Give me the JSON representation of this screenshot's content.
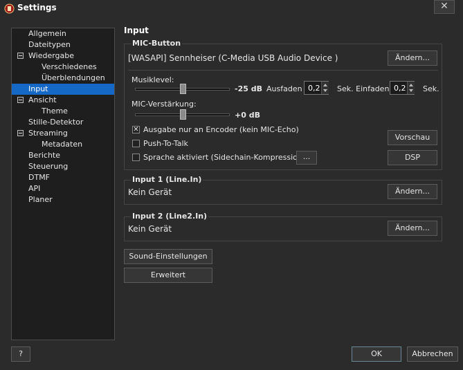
{
  "window": {
    "title": "Settings",
    "close_label": "✕"
  },
  "sidebar": {
    "items": [
      {
        "label": "Allgemein"
      },
      {
        "label": "Dateitypen"
      },
      {
        "label": "Wiedergabe"
      },
      {
        "label": "Verschiedenes"
      },
      {
        "label": "Überblendungen"
      },
      {
        "label": "Input"
      },
      {
        "label": "Ansicht"
      },
      {
        "label": "Theme"
      },
      {
        "label": "Stille-Detektor"
      },
      {
        "label": "Streaming"
      },
      {
        "label": "Metadaten"
      },
      {
        "label": "Berichte"
      },
      {
        "label": "Steuerung"
      },
      {
        "label": "DTMF"
      },
      {
        "label": "API"
      },
      {
        "label": "Planer"
      }
    ]
  },
  "page": {
    "title": "Input"
  },
  "mic_button": {
    "group_label": "MIC-Button",
    "device": "[WASAPI] Sennheiser (C-Media USB Audio Device  )",
    "change_label": "Ändern...",
    "musiklevel_label": "Musiklevel:",
    "musiklevel_value": "-25 dB",
    "ausfaden_label": "Ausfaden",
    "ausfaden_value": "0,2",
    "sek_einfaden_label": "Sek. Einfaden",
    "einfaden_value": "0,2",
    "sek_label": "Sek.",
    "mic_verstaerkung_label": "MIC-Verstärkung:",
    "mic_verstaerkung_value": "+0 dB",
    "ausgabe_label": "Ausgabe nur an Encoder (kein MIC-Echo)",
    "ausgabe_checked": true,
    "push_to_talk_label": "Push-To-Talk",
    "push_to_talk_checked": false,
    "sprache_label": "Sprache aktiviert (Sidechain-Kompression)",
    "sprache_checked": false,
    "ellipsis_label": "...",
    "vorschau_label": "Vorschau",
    "dsp_label": "DSP"
  },
  "input1": {
    "group_label": "Input 1 (Line.In)",
    "device": "Kein Gerät",
    "change_label": "Ändern..."
  },
  "input2": {
    "group_label": "Input 2 (Line2.In)",
    "device": "Kein Gerät",
    "change_label": "Ändern..."
  },
  "buttons": {
    "sound_settings": "Sound-Einstellungen",
    "advanced": "Erweitert",
    "help": "?",
    "ok": "OK",
    "cancel": "Abbrechen"
  },
  "colors": {
    "selection": "#1668c7",
    "background": "#2b2b2b",
    "tree_background": "#1e1e1e"
  }
}
